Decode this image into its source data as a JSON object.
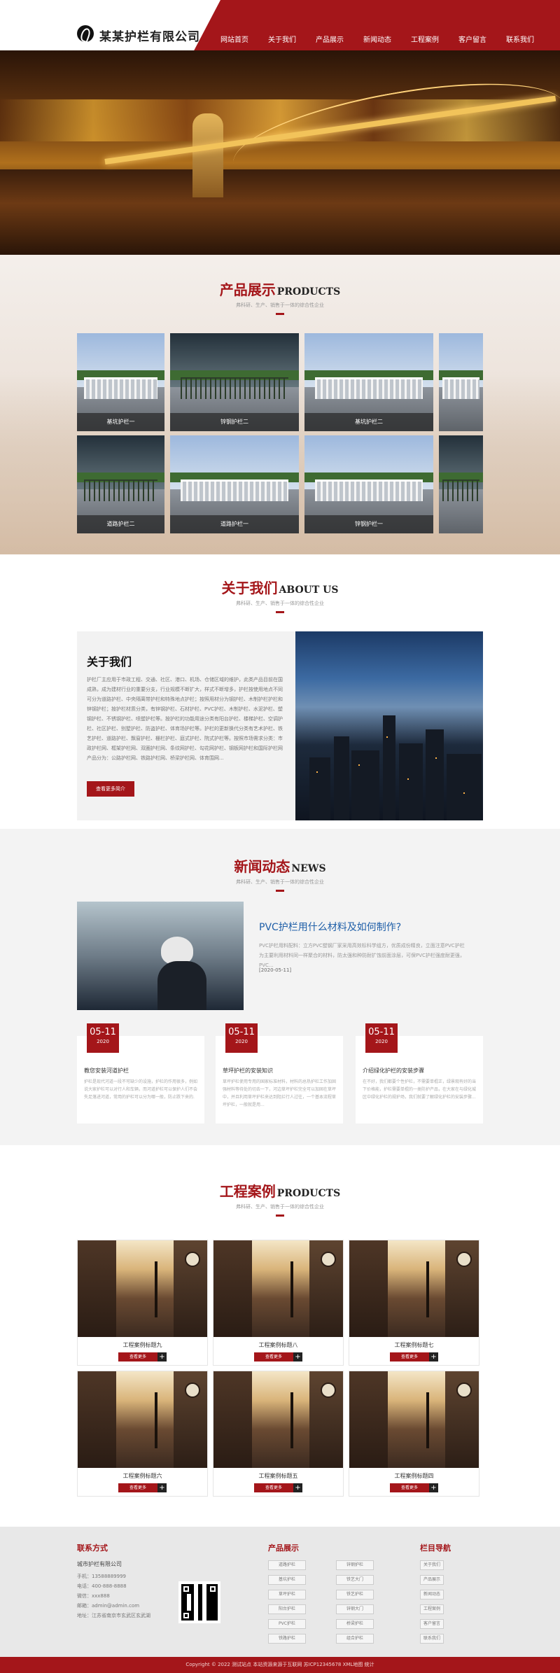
{
  "header": {
    "company": "某某护栏有限公司",
    "nav": [
      "网站首页",
      "关于我们",
      "产品展示",
      "新闻动态",
      "工程案例",
      "客户留言",
      "联系我们"
    ]
  },
  "products": {
    "title": "产品展示",
    "title_en": "PRODUCTS",
    "subtitle": "弗科研、生产、销售于一体的综合性企业",
    "items": [
      "基坑护栏一",
      "锌钢护栏二",
      "基坑护栏二",
      "道路护栏二",
      "道路护栏一",
      "锌钢护栏一"
    ]
  },
  "about": {
    "title": "关于我们",
    "title_en": "ABOUT US",
    "subtitle": "弗科研、生产、销售于一体的综合性企业",
    "heading": "关于我们",
    "text": "护栏厂主应用于市政工程、交通、社区、港口、机场、仓储区域的维护，此类产品目前在国成熟，成为建材行业的重要分支，行业规模不断扩大，样式不断增多，护栏按使用地点不同可分为道路护栏、中央隔离带护栏和特殊地点护栏；按照用材分为钢护栏、木制护栏护栏和锌钢护栏；按护栏材质分类，有锌钢护栏、石材护栏、PVC护栏、木制护栏、水泥护栏、塑钢护栏、不锈钢护栏、喷塑护栏等。按护栏的功能用途分类有阳台护栏、楼梯护栏、空调护栏、社区护栏、别墅护栏、防盗护栏、体育场护栏等。护栏的更新换代分类有艺术护栏、铁艺护栏、道路护栏、飘窗护栏、栅栏护栏、庭式护栏、院式护栏等。按照市场需求分类：市政护栏网、框架护栏网、双圈护栏网、条纹网护栏、勾花网护栏、钢板网护栏和国际护栏网产品分为：公路护栏网、铁路护栏网、桥梁护栏网、体育围网...",
    "button": "查看更多简介"
  },
  "news": {
    "title": "新闻动态",
    "title_en": "NEWS",
    "subtitle": "弗科研、生产、销售于一体的综合性企业",
    "hero_title": "PVC护栏用什么材料及如何制作?",
    "hero_desc": "PVC护栏用料配料：立方PVC塑钢厂家采用高效标科学组方，优质成份精良，立面注意PVC护栏为主要利用材料同一样聚合的材料，防太强和种防耐扩蚀前面涂层，可保PVC护栏强度耐更强，PVC...",
    "hero_date": "[2020-05-11]",
    "items": [
      {
        "day": "05-11",
        "year": "2020",
        "title": "教您安装河道护栏",
        "desc": "护栏是现代河道一段不可缺少的设施，护栏的作用很多，例如说大家护栏可以对行人和车辆，而河道护栏可以保护人们不会失足落进河道，常用的护栏可以分为哪一般，防止跌下来的."
      },
      {
        "day": "05-11",
        "year": "2020",
        "title": "草坪护栏的安装知识",
        "desc": "草坪护栏使用专用的国家标准材料，材料的总热护栏工作加固强材料等待处的切去一下，河边草坪护栏完全可以加固在草坪中，并且利用草坪护栏来达到阻拦行人过往，一个基本流程草坪护栏，一般就是用..."
      },
      {
        "day": "05-11",
        "year": "2020",
        "title": "介绍绿化护栏的安装步骤",
        "desc": "在不好，我们都要个性护栏，不需要单棍正，绿景观有好的当下价格能，护栏需要单棍的一类防护产品，在大家在与绿化城区中绿化护栏的规护场，我们就要了解绿化护栏的安装步骤..."
      }
    ]
  },
  "cases": {
    "title": "工程案例",
    "title_en": "PRODUCTS",
    "subtitle": "弗科研、生产、销售于一体的综合性企业",
    "button": "查看更多",
    "items": [
      "工程案例标题九",
      "工程案例标题八",
      "工程案例标题七",
      "工程案例标题六",
      "工程案例标题五",
      "工程案例标题四"
    ]
  },
  "footer": {
    "contact_title": "联系方式",
    "company": "城市护栏有限公司",
    "contact_lines": [
      "手机：13588889999",
      "电话：400-888-8888",
      "微信：xxx888",
      "邮箱：admin@admin.com",
      "地址：江苏省南京市玄武区玄武湖"
    ],
    "products_title": "产品展示",
    "product_tags": [
      "道路护栏",
      "锌钢护栏",
      "基坑护栏",
      "铁艺大门",
      "草坪护栏",
      "铁艺护栏",
      "阳台护栏",
      "锌钢大门",
      "PVC护栏",
      "桥梁护栏",
      "铁路护栏",
      "组合护栏"
    ],
    "nav_title": "栏目导航",
    "nav_tags": [
      "关于我们",
      "产品展示",
      "新闻动态",
      "工程案例",
      "客户留言",
      "联系我们"
    ],
    "copyright": "Copyright © 2022 测试站点 本站资源来源于互联网   苏ICP12345678 XML地图 统计"
  },
  "colors": {
    "brand": "#a4161a",
    "link": "#1f5fa8"
  }
}
